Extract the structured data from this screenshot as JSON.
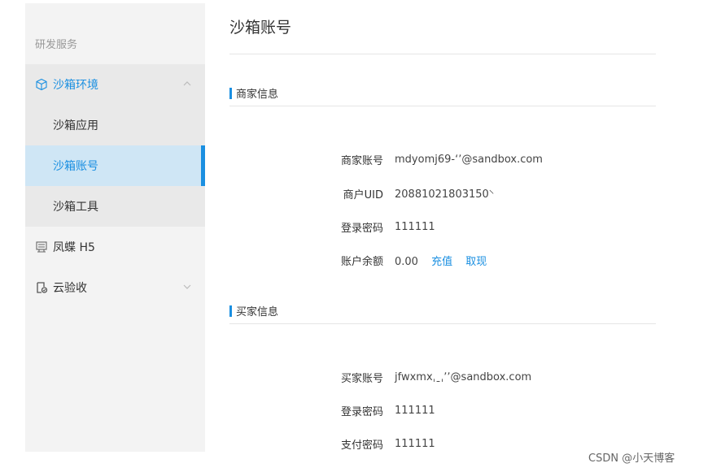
{
  "sidebar": {
    "section_label": "研发服务",
    "items": [
      {
        "label": "沙箱环境",
        "icon": "cube-icon"
      },
      {
        "label": "沙箱应用"
      },
      {
        "label": "沙箱账号"
      },
      {
        "label": "沙箱工具"
      },
      {
        "label": "凤蝶 H5",
        "icon": "fengdie-icon"
      },
      {
        "label": "云验收",
        "icon": "cloud-check-icon"
      }
    ]
  },
  "page": {
    "title": "沙箱账号",
    "merchant": {
      "section_title": "商家信息",
      "rows": [
        {
          "label": "商家账号",
          "value": "mdyomj69-ʻʼ@sandbox.com"
        },
        {
          "label": "商户UID",
          "value": "20881021803150⸌"
        },
        {
          "label": "登录密码",
          "value": "111111"
        },
        {
          "label": "账户余额",
          "value": "0.00",
          "links": [
            "充值",
            "取现"
          ]
        }
      ]
    },
    "buyer": {
      "section_title": "买家信息",
      "rows": [
        {
          "label": "买家账号",
          "value": "jfwxmxˌˍˌʼʼ@sandbox.com"
        },
        {
          "label": "登录密码",
          "value": "111111"
        },
        {
          "label": "支付密码",
          "value": "111111"
        }
      ]
    }
  },
  "watermark": "CSDN @小天博客",
  "colors": {
    "accent": "#1a8fe1",
    "sidebar_bg": "#f3f3f3",
    "group_bg": "#e9e9e9",
    "active_bg": "#cfe6f5"
  }
}
